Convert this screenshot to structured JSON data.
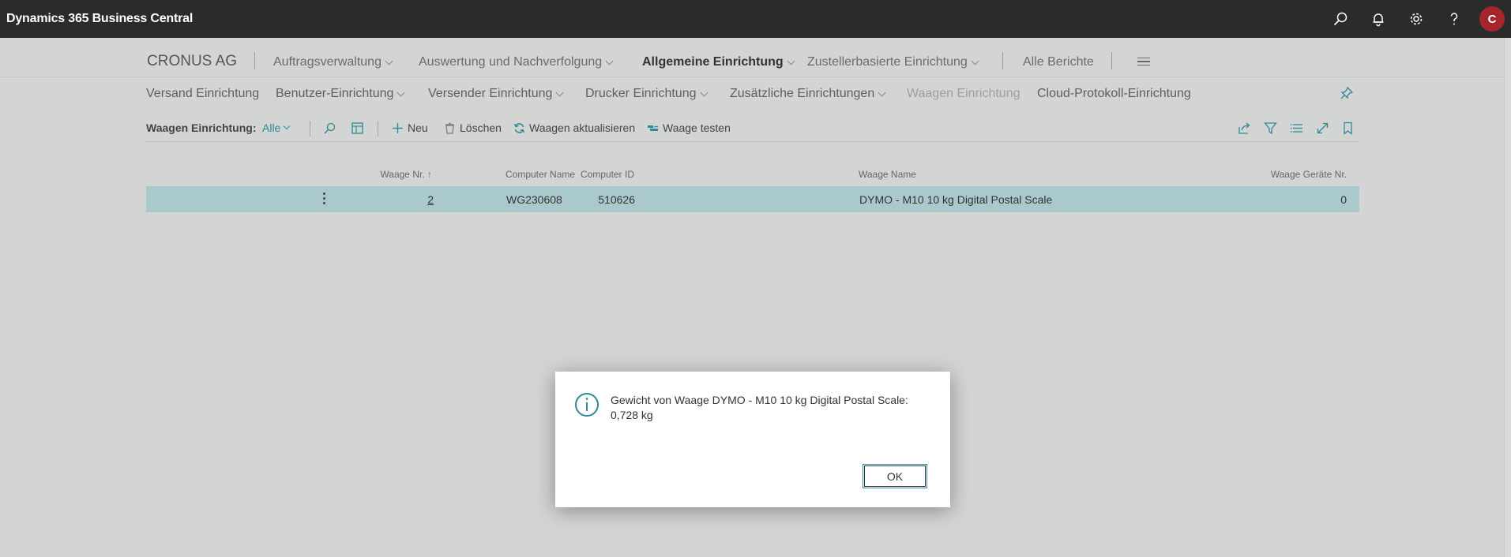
{
  "app": {
    "title": "Dynamics 365 Business Central",
    "user_initial": "C"
  },
  "appbar_icons": [
    "search-icon",
    "bell-icon",
    "gear-icon",
    "help-icon"
  ],
  "nav": {
    "company": "CRONUS AG",
    "items": [
      {
        "label": "Auftragsverwaltung",
        "dropdown": true,
        "active": false
      },
      {
        "label": "Auswertung und Nachverfolgung",
        "dropdown": true,
        "active": false
      },
      {
        "label": "Allgemeine Einrichtung",
        "dropdown": true,
        "active": true
      },
      {
        "label": "Zustellerbasierte Einrichtung",
        "dropdown": true,
        "active": false
      },
      {
        "label": "Alle Berichte",
        "dropdown": false,
        "active": false
      }
    ]
  },
  "subnav": {
    "items": [
      {
        "label": "Versand Einrichtung",
        "dropdown": false,
        "disabled": false
      },
      {
        "label": "Benutzer-Einrichtung",
        "dropdown": true,
        "disabled": false
      },
      {
        "label": "Versender Einrichtung",
        "dropdown": true,
        "disabled": false
      },
      {
        "label": "Drucker Einrichtung",
        "dropdown": true,
        "disabled": false
      },
      {
        "label": "Zusätzliche Einrichtungen",
        "dropdown": true,
        "disabled": false
      },
      {
        "label": "Waagen Einrichtung",
        "dropdown": false,
        "disabled": true
      },
      {
        "label": "Cloud-Protokoll-Einrichtung",
        "dropdown": false,
        "disabled": false
      }
    ]
  },
  "actionbar": {
    "page_label": "Waagen Einrichtung:",
    "filter_value": "Alle",
    "actions": {
      "new": "Neu",
      "delete": "Löschen",
      "refresh": "Waagen aktualisieren",
      "test": "Waage testen"
    }
  },
  "table": {
    "columns": {
      "waage_nr": "Waage Nr.",
      "sort_indicator": "↑",
      "computer_id": "Computer ID",
      "computer_name": "Computer Name",
      "waage_name": "Waage Name",
      "geraete_nr": "Waage Geräte Nr."
    },
    "rows": [
      {
        "waage_nr": "2",
        "computer_id": "510626",
        "computer_name": "WG230608",
        "waage_name": "DYMO - M10 10 kg Digital Postal Scale",
        "geraete_nr": "0"
      }
    ]
  },
  "dialog": {
    "message_line1": "Gewicht von Waage DYMO - M10 10 kg Digital Postal Scale:",
    "message_line2": "0,728 kg",
    "ok_label": "OK"
  },
  "colors": {
    "appbar": "#2b2b2b",
    "background": "#d3d4d4",
    "selected_row": "#a9c9cc",
    "accent": "#2f8a96",
    "avatar": "#a4262c"
  }
}
